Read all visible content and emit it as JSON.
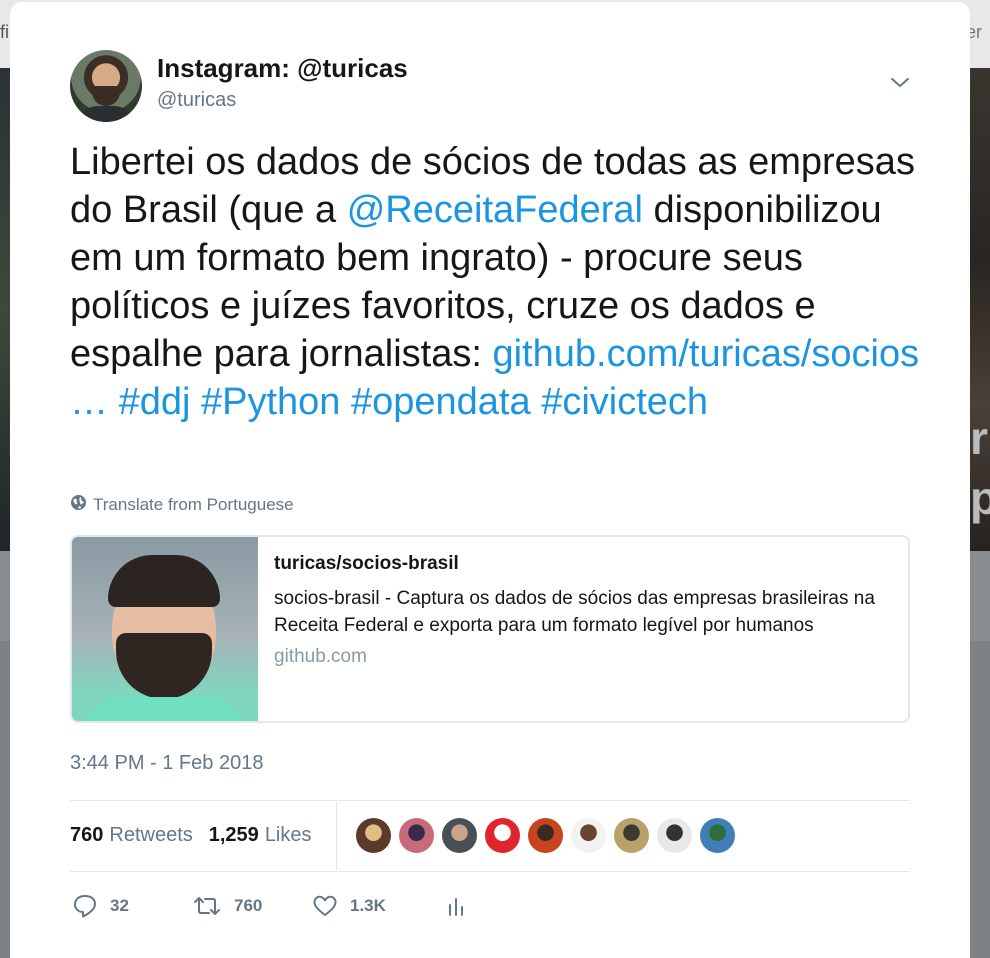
{
  "background": {
    "left_fragment": "fi",
    "right_fragment": "er",
    "photo_fragment": "r\np"
  },
  "tweet": {
    "display_name": "Instagram: @turicas",
    "handle": "@turicas",
    "text_parts": [
      "Libertei os dados de sócios de todas as empresas do Brasil (que a ",
      "@ReceitaFederal",
      " disponibilizou em um formato bem ingrato) - procure seus políticos e juízes favoritos, cruze os dados e espalhe para jornalistas: ",
      "github.com/turicas/socios … ",
      "#ddj",
      " ",
      "#Python",
      " ",
      "#opendata",
      " ",
      "#civictech"
    ],
    "translate_label": "Translate from Portuguese",
    "timestamp": "3:44 PM - 1 Feb 2018"
  },
  "card": {
    "title": "turicas/socios-brasil",
    "description": "socios-brasil - Captura os dados de sócios das empresas brasileiras na Receita Federal e exporta para um formato legível por humanos",
    "domain": "github.com"
  },
  "stats": {
    "retweets_count": "760",
    "retweets_label": "Retweets",
    "likes_count": "1,259",
    "likes_label": "Likes"
  },
  "likers": [
    {
      "name": "liker-1",
      "color": "#5a3a2a",
      "accent": "#e0c080"
    },
    {
      "name": "liker-2",
      "color": "#c76a7a",
      "accent": "#3a2a4a"
    },
    {
      "name": "liker-3",
      "color": "#4a4e55",
      "accent": "#c9a38a"
    },
    {
      "name": "liker-4",
      "color": "#e0252f",
      "accent": "#ffffff"
    },
    {
      "name": "liker-5",
      "color": "#c8441e",
      "accent": "#3a2a22"
    },
    {
      "name": "liker-6",
      "color": "#f2f2f2",
      "accent": "#6b4430"
    },
    {
      "name": "liker-7",
      "color": "#b9a26a",
      "accent": "#3a3a30"
    },
    {
      "name": "liker-8",
      "color": "#e8e8e8",
      "accent": "#333333"
    },
    {
      "name": "liker-9",
      "color": "#3f7fb5",
      "accent": "#2e6e3a"
    }
  ],
  "actions": {
    "reply_count": "32",
    "retweet_count": "760",
    "like_count": "1.3K"
  },
  "colors": {
    "link": "#1b95e0",
    "secondary_text": "#657786"
  }
}
